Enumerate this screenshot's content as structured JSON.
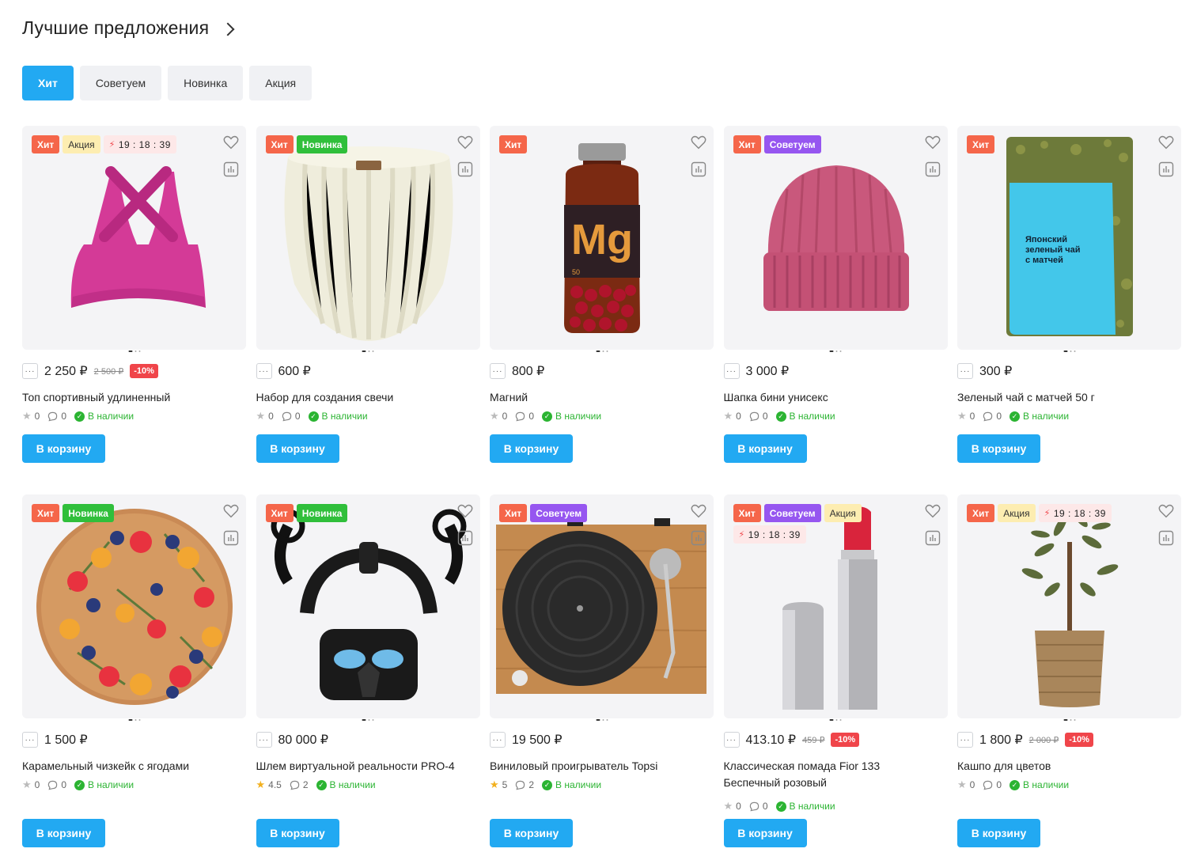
{
  "header": {
    "title": "Лучшие предложения"
  },
  "tabs": [
    {
      "label": "Хит",
      "active": true
    },
    {
      "label": "Советуем",
      "active": false
    },
    {
      "label": "Новинка",
      "active": false
    },
    {
      "label": "Акция",
      "active": false
    }
  ],
  "colors": {
    "accent": "#22a9f2",
    "hit": "#f5664a",
    "new": "#30bf3b",
    "recommend": "#9656f0",
    "sale": "#fdedb1",
    "discount": "#f0454a",
    "in_stock": "#2bb432"
  },
  "cart_label": "В корзину",
  "products": [
    {
      "name": "Топ спортивный удлиненный",
      "image": "pink-sports-bra",
      "price": "2 250 ₽",
      "old_price": "2 500 ₽",
      "discount": "-10%",
      "rating": "0",
      "reviews": "0",
      "stock": "В наличии",
      "badges": [
        "Хит",
        "Акция",
        "19 : 18 : 39"
      ]
    },
    {
      "name": "Набор для создания свечи",
      "image": "white-candle",
      "price": "600 ₽",
      "rating": "0",
      "reviews": "0",
      "stock": "В наличии",
      "badges": [
        "Хит",
        "Новинка"
      ]
    },
    {
      "name": "Магний",
      "image": "magnesium-bottle",
      "price": "800 ₽",
      "rating": "0",
      "reviews": "0",
      "stock": "В наличии",
      "badges": [
        "Хит"
      ]
    },
    {
      "name": "Шапка бини унисекс",
      "image": "pink-beanie",
      "price": "3 000 ₽",
      "rating": "0",
      "reviews": "0",
      "stock": "В наличии",
      "badges": [
        "Хит",
        "Советуем"
      ]
    },
    {
      "name": "Зеленый чай с матчей 50 г",
      "image": "tea-pack",
      "price": "300 ₽",
      "rating": "0",
      "reviews": "0",
      "stock": "В наличии",
      "badges": [
        "Хит"
      ],
      "pack_text": [
        "Японский",
        "зеленый чай",
        "с матчей"
      ]
    },
    {
      "name": "Карамельный чизкейк с ягодами",
      "image": "caramel-cheesecake",
      "price": "1 500 ₽",
      "rating": "0",
      "reviews": "0",
      "stock": "В наличии",
      "badges": [
        "Хит",
        "Новинка"
      ]
    },
    {
      "name": "Шлем виртуальной реальности PRO-4",
      "image": "vr-headset",
      "price": "80 000 ₽",
      "rating": "4.5",
      "reviews": "2",
      "stock": "В наличии",
      "badges": [
        "Хит",
        "Новинка"
      ]
    },
    {
      "name": "Виниловый проигрыватель Topsi",
      "image": "turntable",
      "price": "19 500 ₽",
      "rating": "5",
      "reviews": "2",
      "stock": "В наличии",
      "badges": [
        "Хит",
        "Советуем"
      ]
    },
    {
      "name": "Классическая помада Fior 133 Беспечный розовый",
      "image": "lipstick",
      "price": "413.10 ₽",
      "old_price": "459 ₽",
      "discount": "-10%",
      "rating": "0",
      "reviews": "0",
      "stock": "В наличии",
      "badges": [
        "Хит",
        "Советуем",
        "Акция",
        "19 : 18 : 39"
      ]
    },
    {
      "name": "Кашпо для цветов",
      "image": "plant-pot",
      "price": "1 800 ₽",
      "old_price": "2 000 ₽",
      "discount": "-10%",
      "rating": "0",
      "reviews": "0",
      "stock": "В наличии",
      "badges": [
        "Хит",
        "Акция",
        "19 : 18 : 39"
      ]
    }
  ]
}
